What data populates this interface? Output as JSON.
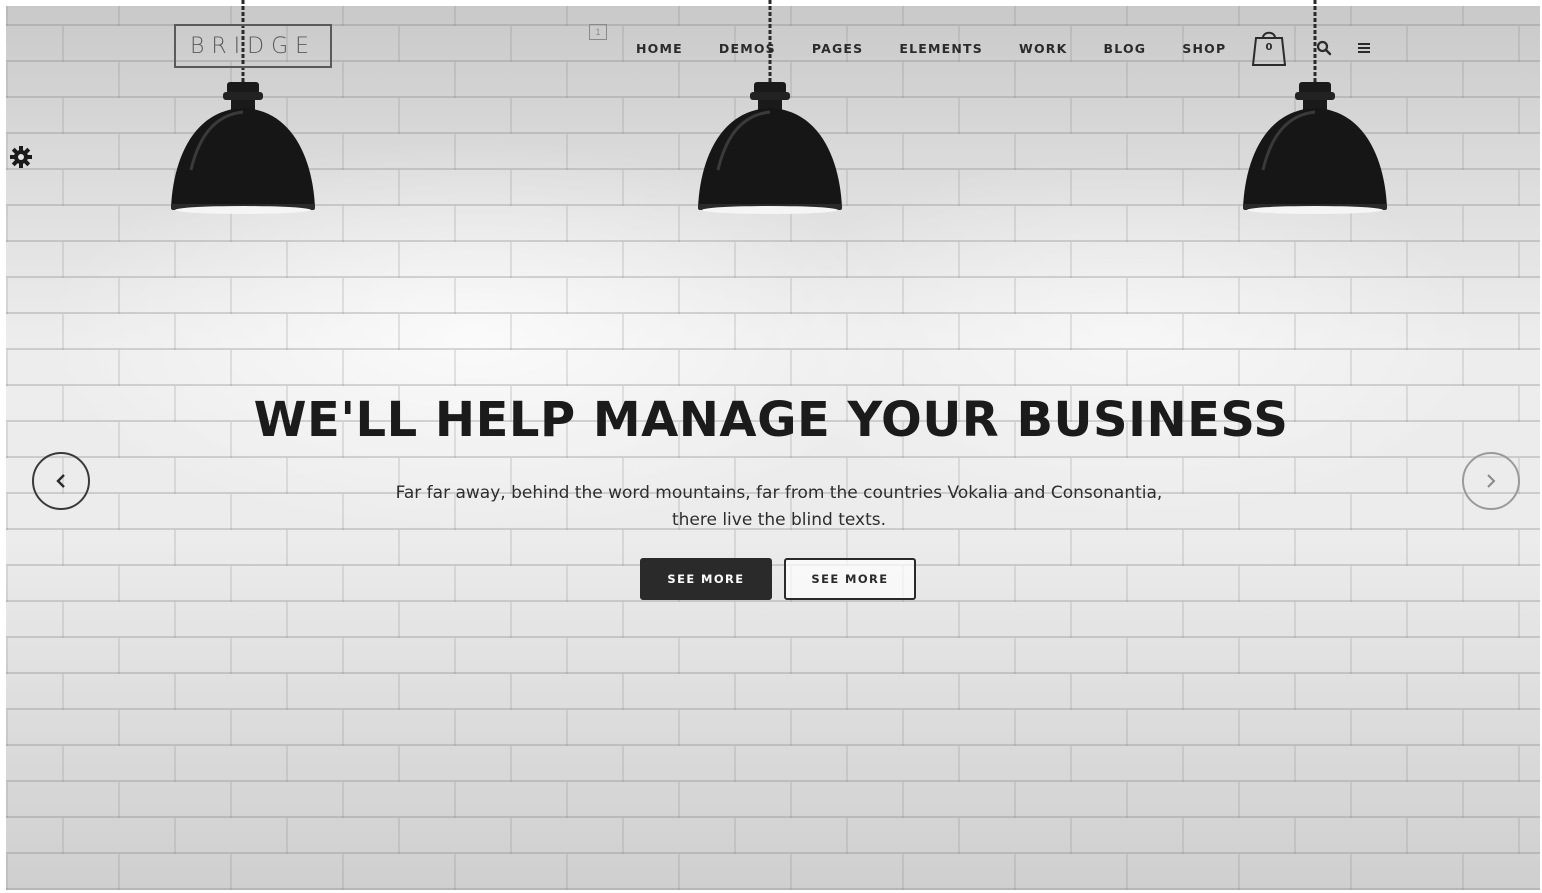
{
  "header": {
    "logo_text": "BRIDGE",
    "small_box_label": "1",
    "nav": [
      {
        "label": "HOME"
      },
      {
        "label": "DEMOS"
      },
      {
        "label": "PAGES"
      },
      {
        "label": "ELEMENTS"
      },
      {
        "label": "WORK"
      },
      {
        "label": "BLOG"
      },
      {
        "label": "SHOP"
      }
    ],
    "cart_count": "0"
  },
  "slider": {
    "title": "WE'LL HELP MANAGE YOUR BUSINESS",
    "subtitle_line1": "Far far away, behind the word mountains, far from the countries Vokalia and Consonantia,",
    "subtitle_line2": "there live the blind texts.",
    "button_primary": "SEE MORE",
    "button_secondary": "SEE MORE"
  },
  "icons": {
    "settings": "gear-icon",
    "cart": "shopping-bag-icon",
    "search": "search-icon",
    "menu": "hamburger-icon",
    "prev": "chevron-left-icon",
    "next": "chevron-right-icon"
  },
  "colors": {
    "text_dark": "#1b1b1b",
    "button_dark": "#2a2a2a",
    "wall": "#e6e6e6"
  }
}
